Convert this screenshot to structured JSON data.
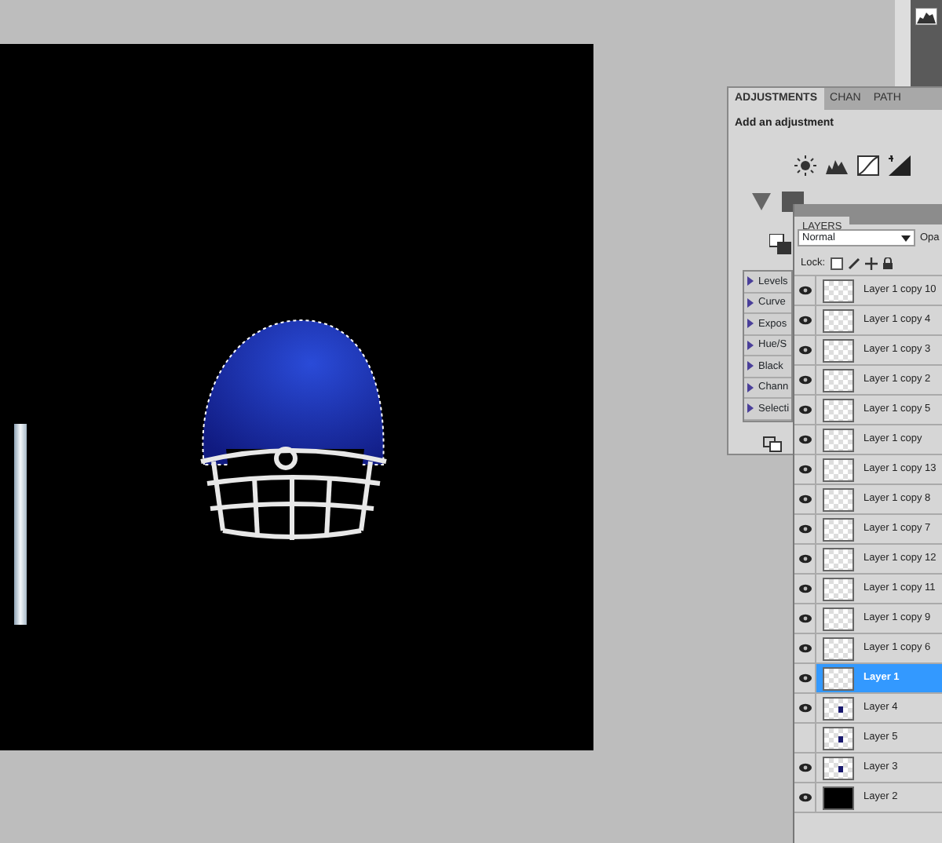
{
  "adjustments": {
    "tabs": [
      {
        "label": "ADJUSTMENTS",
        "selected": true
      },
      {
        "label": "CHAN",
        "selected": false
      },
      {
        "label": "PATH",
        "selected": false
      }
    ],
    "heading": "Add an adjustment",
    "presets": [
      "Levels",
      "Curve",
      "Expos",
      "Hue/S",
      "Black",
      "Chann",
      "Selecti"
    ]
  },
  "layers": {
    "title": "LAYERS",
    "blend_mode": "Normal",
    "opacity_label": "Opa",
    "lock_label": "Lock:",
    "items": [
      {
        "name": "Layer 1 copy 10",
        "visible": true,
        "selected": false,
        "kind": "transparent"
      },
      {
        "name": "Layer 1 copy 4",
        "visible": true,
        "selected": false,
        "kind": "transparent"
      },
      {
        "name": "Layer 1 copy 3",
        "visible": true,
        "selected": false,
        "kind": "transparent"
      },
      {
        "name": "Layer 1 copy 2",
        "visible": true,
        "selected": false,
        "kind": "transparent"
      },
      {
        "name": "Layer 1 copy 5",
        "visible": true,
        "selected": false,
        "kind": "transparent"
      },
      {
        "name": "Layer 1 copy",
        "visible": true,
        "selected": false,
        "kind": "transparent"
      },
      {
        "name": "Layer 1 copy 13",
        "visible": true,
        "selected": false,
        "kind": "transparent"
      },
      {
        "name": "Layer 1 copy 8",
        "visible": true,
        "selected": false,
        "kind": "transparent"
      },
      {
        "name": "Layer 1 copy 7",
        "visible": true,
        "selected": false,
        "kind": "transparent"
      },
      {
        "name": "Layer 1 copy 12",
        "visible": true,
        "selected": false,
        "kind": "transparent"
      },
      {
        "name": "Layer 1 copy 11",
        "visible": true,
        "selected": false,
        "kind": "transparent"
      },
      {
        "name": "Layer 1 copy 9",
        "visible": true,
        "selected": false,
        "kind": "transparent"
      },
      {
        "name": "Layer 1 copy 6",
        "visible": true,
        "selected": false,
        "kind": "transparent"
      },
      {
        "name": "Layer 1",
        "visible": true,
        "selected": true,
        "kind": "transparent"
      },
      {
        "name": "Layer 4",
        "visible": true,
        "selected": false,
        "kind": "mark"
      },
      {
        "name": "Layer 5",
        "visible": false,
        "selected": false,
        "kind": "mark"
      },
      {
        "name": "Layer 3",
        "visible": true,
        "selected": false,
        "kind": "mark"
      },
      {
        "name": "Layer 2",
        "visible": true,
        "selected": false,
        "kind": "black"
      }
    ]
  }
}
